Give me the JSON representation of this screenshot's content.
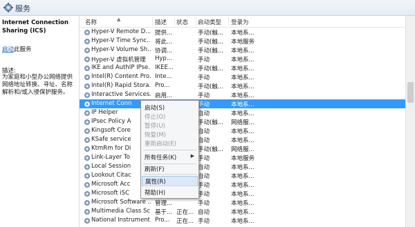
{
  "window": {
    "title": "服务"
  },
  "left_panel": {
    "service_title": "Internet Connection Sharing (ICS)",
    "start_link": "启动",
    "start_suffix": "此服务",
    "desc_label": "描述:",
    "desc_text": "为家庭和小型办公网络提供网络地址转换、寻址、名称解析和/或入侵保护服务。"
  },
  "columns": {
    "name": "名称",
    "desc": "描述",
    "status": "状态",
    "startup": "启动类型",
    "logon": "登录为"
  },
  "rows": [
    {
      "name": "Hyper-V Remote D...",
      "desc": "提供...",
      "status": "",
      "startup": "手动(触...",
      "logon": "本地系..."
    },
    {
      "name": "Hyper-V Time Sync...",
      "desc": "将此...",
      "status": "",
      "startup": "手动(触...",
      "logon": "本地服务"
    },
    {
      "name": "Hyper-V Volume Sh...",
      "desc": "协调...",
      "status": "",
      "startup": "手动(触...",
      "logon": "本地系..."
    },
    {
      "name": "Hyper-V 虚拟机管理",
      "desc": "Hyp...",
      "status": "",
      "startup": "手动",
      "logon": "本地系..."
    },
    {
      "name": "IKE and AuthIP IPse...",
      "desc": "IKEE...",
      "status": "",
      "startup": "手动(触...",
      "logon": "本地系..."
    },
    {
      "name": "Intel(R) Content Pro...",
      "desc": "Inte...",
      "status": "",
      "startup": "手动",
      "logon": "本地系..."
    },
    {
      "name": "Intel(R) Rapid Stora...",
      "desc": "Pro...",
      "status": "",
      "startup": "手动(触...",
      "logon": "本地系..."
    },
    {
      "name": "Interactive Services...",
      "desc": "启用...",
      "status": "",
      "startup": "手动",
      "logon": "本地系..."
    },
    {
      "name": "Internet Conn",
      "desc": "",
      "status": "",
      "startup": "手动",
      "logon": "本地系..."
    },
    {
      "name": "IP Helper",
      "desc": "",
      "status": "",
      "startup": "自动",
      "logon": "本地系..."
    },
    {
      "name": "IPsec Policy A",
      "desc": "",
      "status": "",
      "startup": "手动(触...",
      "logon": "网络服..."
    },
    {
      "name": "Kingsoft Core",
      "desc": "",
      "status": "",
      "startup": "自动",
      "logon": "本地系..."
    },
    {
      "name": "KSafe service",
      "desc": "",
      "status": "",
      "startup": "自动",
      "logon": "本地系..."
    },
    {
      "name": "KtmRm for Di",
      "desc": "",
      "status": "",
      "startup": "手动(触...",
      "logon": "网络服..."
    },
    {
      "name": "Link-Layer To",
      "desc": "",
      "status": "",
      "startup": "手动",
      "logon": "本地服务"
    },
    {
      "name": "Local Session",
      "desc": "",
      "status": "",
      "startup": "自动",
      "logon": "本地系..."
    },
    {
      "name": "Lookout Citac",
      "desc": "",
      "status": "",
      "startup": "自动",
      "logon": "本地系..."
    },
    {
      "name": "Microsoft Acc",
      "desc": "",
      "status": "",
      "startup": "手动",
      "logon": "本地系..."
    },
    {
      "name": "Microsoft iSC",
      "desc": "",
      "status": "",
      "startup": "手动",
      "logon": "本地系..."
    },
    {
      "name": "Microsoft Software ...",
      "desc": "管理...",
      "status": "",
      "startup": "手动",
      "logon": "本地系..."
    },
    {
      "name": "Multimedia Class Sc...",
      "desc": "基于...",
      "status": "正在...",
      "startup": "自动",
      "logon": "本地系..."
    },
    {
      "name": "National Instrument...",
      "desc": "Pro...",
      "status": "正在...",
      "startup": "手动",
      "logon": "本地系..."
    }
  ],
  "context_menu": {
    "start": "启动(S)",
    "stop": "停止(O)",
    "pause": "暂停(U)",
    "resume": "恢复(M)",
    "restart": "重新启动(E)",
    "all_tasks": "所有任务(K)",
    "refresh": "刷新(F)",
    "properties": "属性(R)",
    "help": "帮助(H)"
  }
}
